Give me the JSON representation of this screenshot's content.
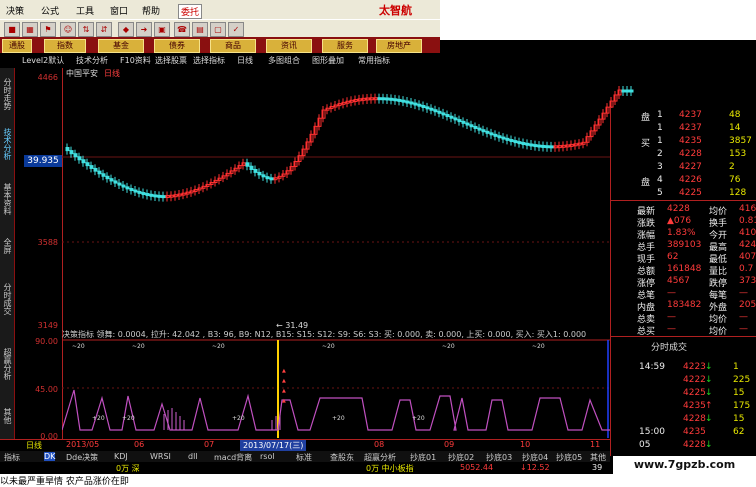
{
  "menu": {
    "items": [
      "决策",
      "公式",
      "工具",
      "窗口",
      "帮助",
      "委托"
    ],
    "logo": "太智航"
  },
  "toolbar": {
    "icons": [
      "stop-icon",
      "grid-icon",
      "flag-icon",
      "people-icon",
      "sort-icon",
      "diamond-icon",
      "arrow-icon",
      "frame-icon",
      "phone-icon",
      "grid2-icon",
      "frame2-icon",
      "check-icon"
    ]
  },
  "categories": [
    "通股",
    "指数",
    "基金",
    "债券",
    "商品",
    "资讯",
    "服务",
    "房地产"
  ],
  "func_tabs": [
    "Level2默认",
    "技术分析",
    "F10资料",
    "选择股票",
    "选择指标",
    "日线",
    "多图组合",
    "图形叠加",
    "常用指标"
  ],
  "left_tabs": [
    "分时走势",
    "技术分析",
    "基本资料",
    "全屏",
    "分时成交",
    "超赢分析",
    "其他"
  ],
  "main_chart": {
    "stock_name": "中国平安",
    "period": "日线",
    "axis_labels": [
      "4466",
      "3588",
      "3149"
    ],
    "price_box": "39.935",
    "low_marker": "← 31.49"
  },
  "indicator": {
    "header": "决策指标 领舞: 0.0004, 拉升: 42.042 , B3: 96, B9: N12, B15: S15: S12: S9: S6: S3: 买: 0.000, 卖: 0.000, 上买: 0.000, 买入: 买入1: 0.000",
    "axis_labels": [
      "90.00",
      "45.00",
      "0.00"
    ]
  },
  "date_bar": {
    "label": "日线",
    "dates": [
      "2013/05",
      "06",
      "07",
      "08",
      "09",
      "10",
      "11"
    ],
    "cursor_date": "2013/07/17(三)"
  },
  "bottom_tabs": [
    "指标",
    "DK",
    "Dde决策",
    "KDJ",
    "WRSI",
    "dll",
    "macd背离",
    "rsol",
    "标准",
    "查股东",
    "超赢分析",
    "抄底01",
    "抄底02",
    "抄底03",
    "抄底04",
    "抄底05",
    "其他"
  ],
  "status_bar": {
    "vol": "0万 深",
    "vol2": "0万 中小板指",
    "val1": "5052.44",
    "arrow": "↓12.52",
    "cut": "39"
  },
  "ticker": "以未最严重旱情 农产品涨价在即",
  "watermark": "www.7gpzb.com",
  "order_book": {
    "sell": [
      {
        "side": "盘",
        "lvl": "1",
        "price": "4237",
        "vol": "48"
      },
      {
        "side": "",
        "lvl": "1",
        "price": "4237",
        "vol": "14"
      }
    ],
    "buy": [
      {
        "side": "买",
        "lvl": "1",
        "price": "4235",
        "vol": "3857"
      },
      {
        "side": "",
        "lvl": "2",
        "price": "4228",
        "vol": "153"
      },
      {
        "side": "",
        "lvl": "3",
        "price": "4227",
        "vol": "2"
      },
      {
        "side": "盘",
        "lvl": "4",
        "price": "4226",
        "vol": "76"
      },
      {
        "side": "",
        "lvl": "5",
        "price": "4225",
        "vol": "128"
      }
    ]
  },
  "quote": [
    {
      "l1": "最新",
      "v1": "4228",
      "l2": "均价",
      "v2": "416"
    },
    {
      "l1": "涨跌",
      "v1": "▲076",
      "l2": "换手",
      "v2": "0.81"
    },
    {
      "l1": "涨幅",
      "v1": "1.83%",
      "l2": "今开",
      "v2": "410"
    },
    {
      "l1": "总手",
      "v1": "389103",
      "l2": "最高",
      "v2": "424"
    },
    {
      "l1": "现手",
      "v1": "62",
      "l2": "最低",
      "v2": "407"
    },
    {
      "l1": "总额",
      "v1": "161848",
      "l2": "量比",
      "v2": "0.7"
    },
    {
      "l1": "涨停",
      "v1": "4567",
      "l2": "跌停",
      "v2": "373"
    },
    {
      "l1": "总笔",
      "v1": "—",
      "l2": "每笔",
      "v2": "—"
    },
    {
      "l1": "内盘",
      "v1": "183482",
      "l2": "外盘",
      "v2": "20562"
    },
    {
      "l1": "总卖",
      "v1": "—",
      "l2": "均价",
      "v2": "—"
    },
    {
      "l1": "总买",
      "v1": "—",
      "l2": "均价",
      "v2": "—"
    }
  ],
  "ticks_header": "分时成交",
  "ticks": [
    {
      "time": "14:59",
      "price": "4223",
      "dir": "↓",
      "vol": "1"
    },
    {
      "time": "",
      "price": "4222",
      "dir": "↓",
      "vol": "225"
    },
    {
      "time": "",
      "price": "4225",
      "dir": "↓",
      "vol": "15"
    },
    {
      "time": "",
      "price": "4235",
      "dir": "↑",
      "vol": "175"
    },
    {
      "time": "",
      "price": "4228",
      "dir": "↓",
      "vol": "15"
    },
    {
      "time": "15:00",
      "price": "4235",
      "dir": "",
      "vol": "62"
    },
    {
      "time": "05",
      "price": "4228",
      "dir": "↓",
      "vol": ""
    }
  ]
}
